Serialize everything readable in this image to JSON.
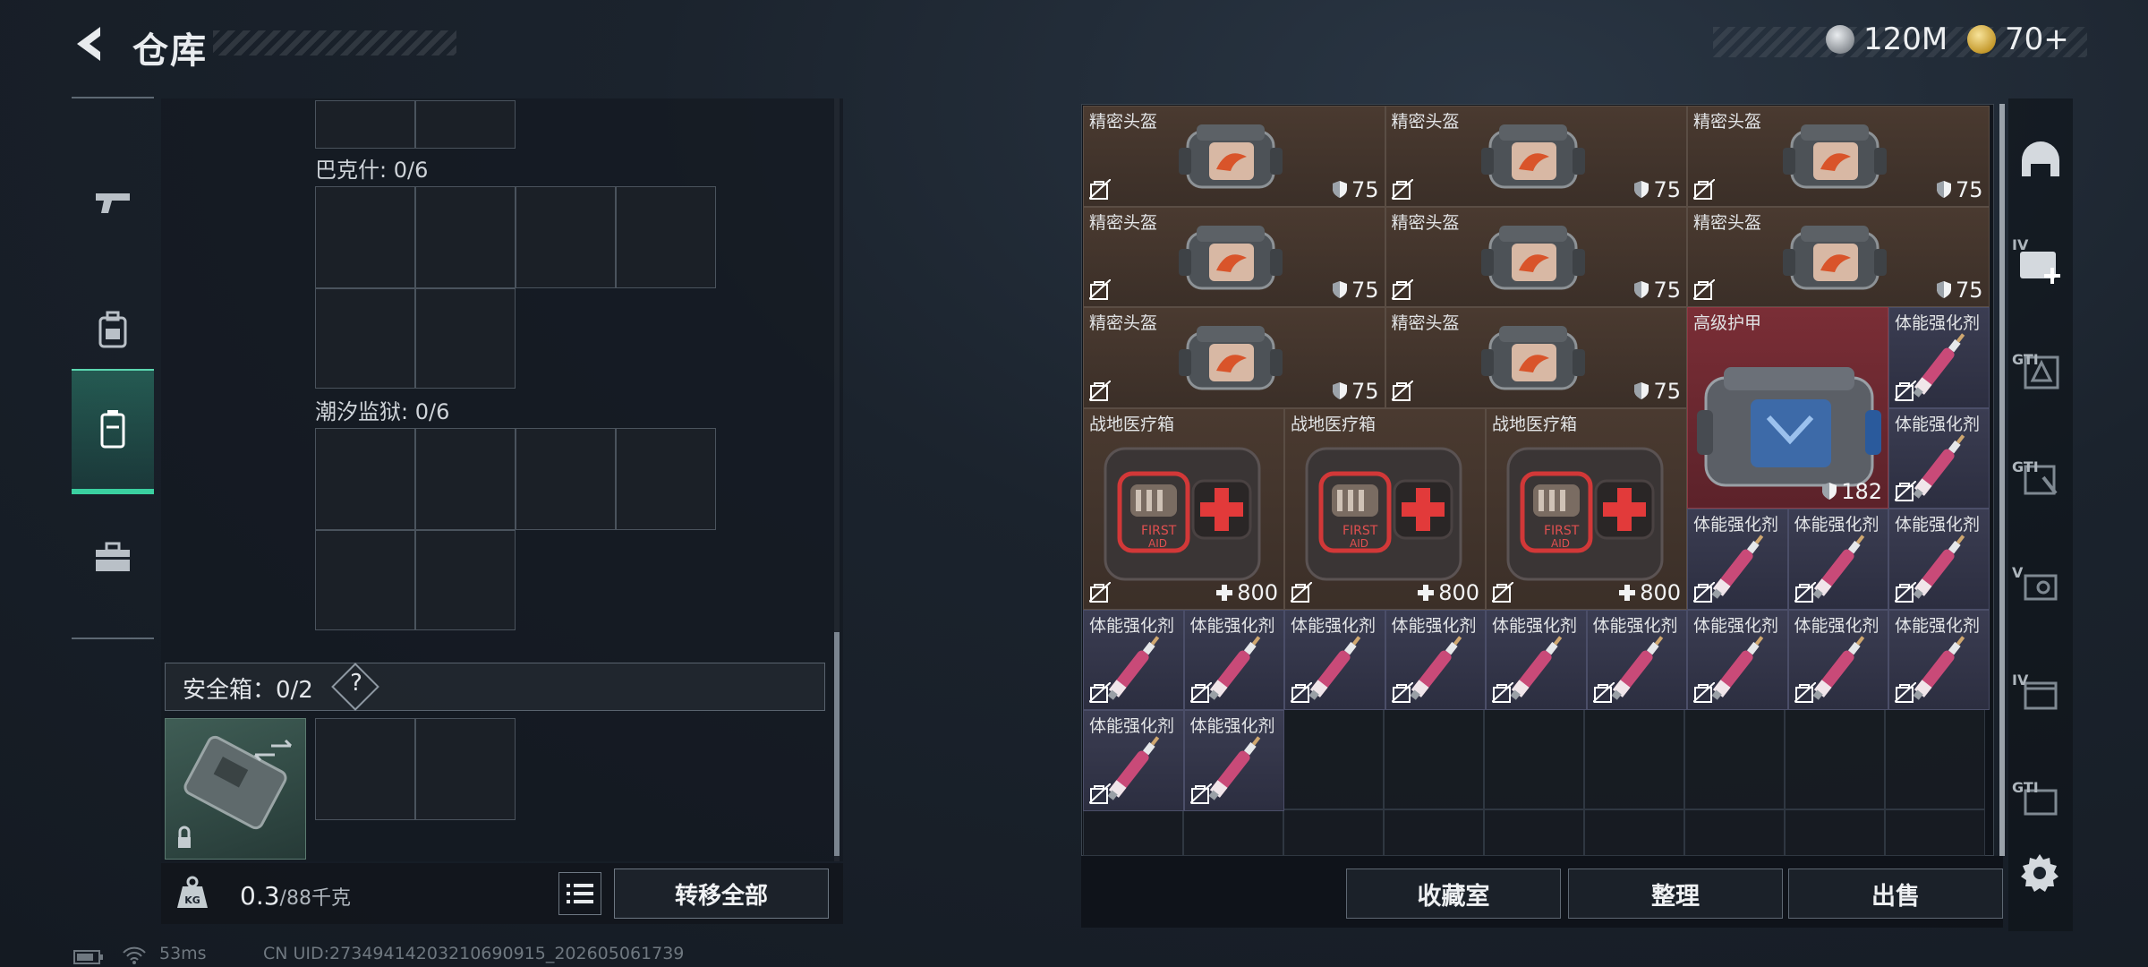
{
  "header": {
    "title": "仓库"
  },
  "currency": {
    "silver": "120M",
    "gold": "70+"
  },
  "left_panel": {
    "bakshi_label": "巴克什: 0/6",
    "tidal_prison_label": "潮汐监狱: 0/6",
    "safebox_label": "安全箱：0/2",
    "help": "?",
    "weight_current": "0.3",
    "weight_max": "/88千克",
    "weight_icon_text": "KG",
    "transfer_all": "转移全部"
  },
  "inventory": {
    "items": [
      {
        "name": "精密头盔",
        "stat": "75",
        "kind": "helmet"
      },
      {
        "name": "精密头盔",
        "stat": "75",
        "kind": "helmet"
      },
      {
        "name": "精密头盔",
        "stat": "75",
        "kind": "helmet"
      },
      {
        "name": "精密头盔",
        "stat": "75",
        "kind": "helmet"
      },
      {
        "name": "精密头盔",
        "stat": "75",
        "kind": "helmet"
      },
      {
        "name": "精密头盔",
        "stat": "75",
        "kind": "helmet"
      },
      {
        "name": "精密头盔",
        "stat": "75",
        "kind": "helmet"
      },
      {
        "name": "精密头盔",
        "stat": "75",
        "kind": "helmet"
      },
      {
        "name": "高级护甲",
        "stat": "182",
        "kind": "armor"
      },
      {
        "name": "战地医疗箱",
        "stat": "800",
        "kind": "medkit"
      },
      {
        "name": "战地医疗箱",
        "stat": "800",
        "kind": "medkit"
      },
      {
        "name": "战地医疗箱",
        "stat": "800",
        "kind": "medkit"
      },
      {
        "name": "体能强化剂",
        "stat": "",
        "kind": "syringe"
      }
    ]
  },
  "bottom_buttons": {
    "collection": "收藏室",
    "organize": "整理",
    "sell": "出售"
  },
  "side_tabs": {
    "tab2": "IV",
    "tab3": "GTI",
    "tab4": "GTI",
    "tab5": "V",
    "tab6": "IV",
    "tab7": "GTI"
  },
  "status": {
    "ping": "53ms",
    "uid": "CN UID:27349414203210690915_202605061739"
  },
  "colors": {
    "accent": "#3ad0a0",
    "brown_item": "#4a3a30",
    "purple_item": "#3b3d52",
    "red_item": "#7a2e36",
    "medkit_cross": "#e23a3a"
  }
}
